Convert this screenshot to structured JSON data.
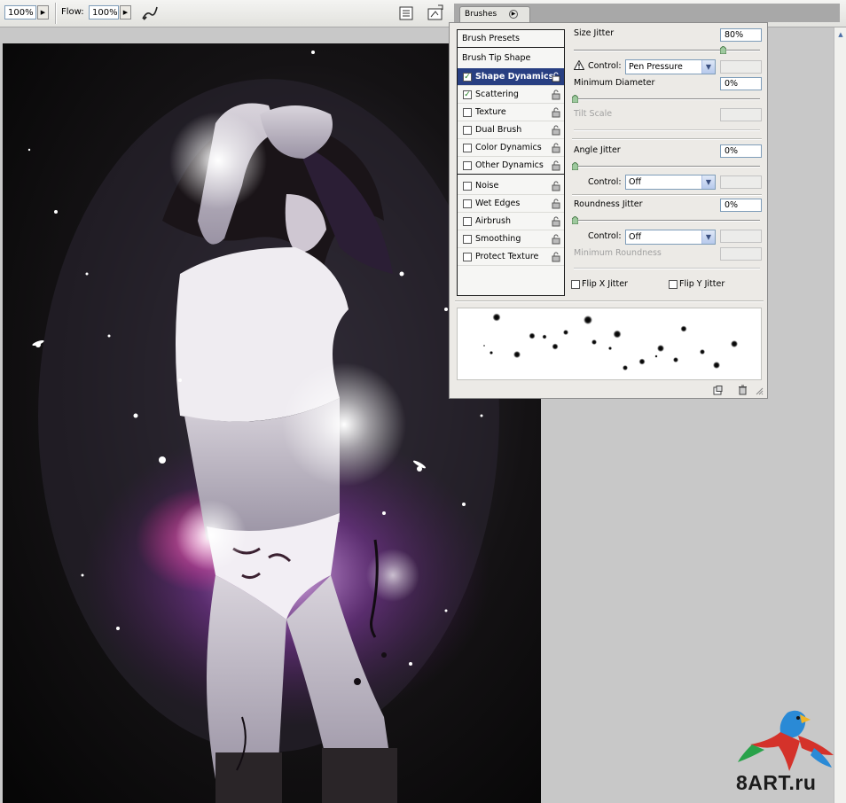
{
  "options_bar": {
    "opacity_value": "100%",
    "flow_label": "Flow:",
    "flow_value": "100%"
  },
  "panel_tab": {
    "title": "Brushes"
  },
  "brush_list": {
    "presets": "Brush Presets",
    "tip_shape": "Brush Tip Shape",
    "items": [
      {
        "label": "Shape Dynamics",
        "checked": true,
        "selected": true
      },
      {
        "label": "Scattering",
        "checked": true,
        "selected": false
      },
      {
        "label": "Texture",
        "checked": false,
        "selected": false
      },
      {
        "label": "Dual Brush",
        "checked": false,
        "selected": false
      },
      {
        "label": "Color Dynamics",
        "checked": false,
        "selected": false
      },
      {
        "label": "Other Dynamics",
        "checked": false,
        "selected": false
      },
      {
        "label": "Noise",
        "checked": false,
        "selected": false
      },
      {
        "label": "Wet Edges",
        "checked": false,
        "selected": false
      },
      {
        "label": "Airbrush",
        "checked": false,
        "selected": false
      },
      {
        "label": "Smoothing",
        "checked": false,
        "selected": false
      },
      {
        "label": "Protect Texture",
        "checked": false,
        "selected": false
      }
    ]
  },
  "shape_dynamics": {
    "size_jitter_label": "Size Jitter",
    "size_jitter_value": "80%",
    "size_jitter_fraction": 0.8,
    "control_label": "Control:",
    "size_control": "Pen Pressure",
    "min_diameter_label": "Minimum Diameter",
    "min_diameter_value": "0%",
    "tilt_scale_label": "Tilt Scale",
    "angle_jitter_label": "Angle Jitter",
    "angle_jitter_value": "0%",
    "angle_control": "Off",
    "roundness_jitter_label": "Roundness Jitter",
    "roundness_jitter_value": "0%",
    "roundness_control": "Off",
    "min_roundness_label": "Minimum Roundness",
    "flip_x_label": "Flip X Jitter",
    "flip_y_label": "Flip Y Jitter"
  },
  "watermark": {
    "text": "8ART.ru"
  },
  "colors": {
    "selected_row": "#283f82",
    "panel_bg": "#eceae6",
    "canvas_bg": "#c8c8c8"
  }
}
